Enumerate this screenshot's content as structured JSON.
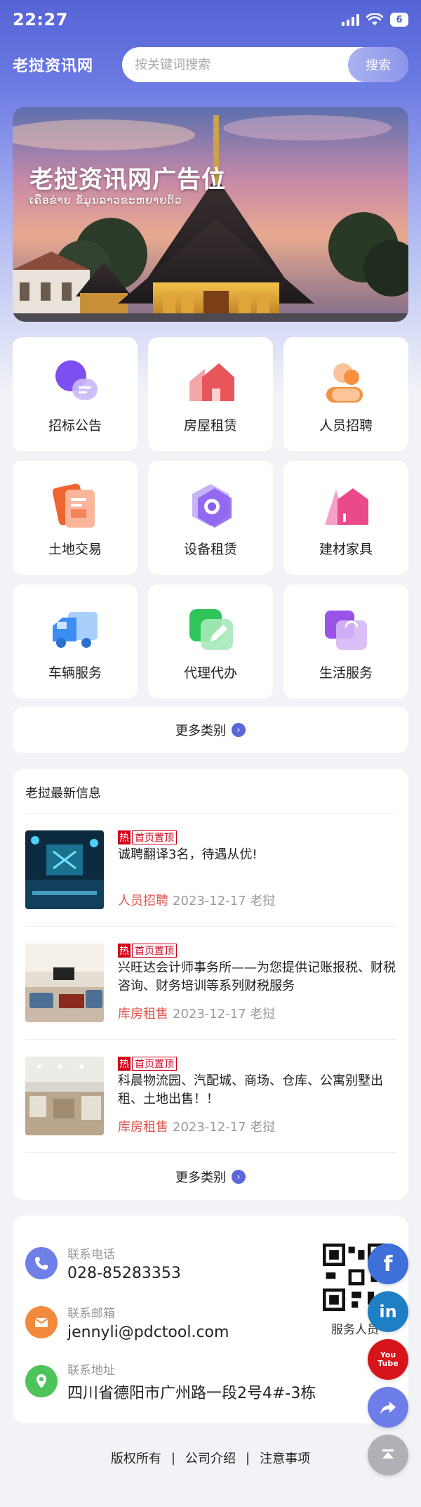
{
  "status_bar": {
    "time": "22:27",
    "battery": "6"
  },
  "header": {
    "logo": "老挝资讯网",
    "search_placeholder": "按关键词搜索",
    "search_button": "搜索"
  },
  "banner": {
    "title": "老挝资讯网广告位",
    "subtitle": "ເຄືອຂ່າຍ ຂໍ້ມູນລາວຂະຫຍາຍຕົວ"
  },
  "categories": [
    {
      "label": "招标公告",
      "icon": "chat-bubble-icon",
      "color": "#7b4ff0"
    },
    {
      "label": "房屋租赁",
      "icon": "house-icon",
      "color": "#e8555a"
    },
    {
      "label": "人员招聘",
      "icon": "person-icon",
      "color": "#f5913e"
    },
    {
      "label": "土地交易",
      "icon": "document-icon",
      "color": "#f0642f"
    },
    {
      "label": "设备租赁",
      "icon": "hexagon-gear-icon",
      "color": "#8a5cf0"
    },
    {
      "label": "建材家具",
      "icon": "building-icon",
      "color": "#e84a8a"
    },
    {
      "label": "车辆服务",
      "icon": "truck-icon",
      "color": "#3d8ef2"
    },
    {
      "label": "代理代办",
      "icon": "pencil-note-icon",
      "color": "#2fc55a"
    },
    {
      "label": "生活服务",
      "icon": "shopping-bag-icon",
      "color": "#9b52e8"
    }
  ],
  "more_categories": "更多类别",
  "news": {
    "title": "老挝最新信息",
    "hot_tag": "热",
    "top_tag": "首页置顶",
    "items": [
      {
        "text": "诚聘翻译3名，待遇从优!",
        "category": "人员招聘",
        "date": "2023-12-17",
        "location": "老挝"
      },
      {
        "text": "兴旺达会计师事务所——为您提供记账报税、财税咨询、财务培训等系列财税服务",
        "category": "库房租售",
        "date": "2023-12-17",
        "location": "老挝"
      },
      {
        "text": "科晨物流园、汽配城、商场、仓库、公寓别墅出租、土地出售！！",
        "category": "库房租售",
        "date": "2023-12-17",
        "location": "老挝"
      }
    ],
    "more": "更多类别"
  },
  "contact": {
    "phone_label": "联系电话",
    "phone": "028-85283353",
    "email_label": "联系邮箱",
    "email": "jennyli@pdctool.com",
    "address_label": "联系地址",
    "address": "四川省德阳市广州路一段2号4#-3栋",
    "qr_label": "服务人员"
  },
  "footer": {
    "links": [
      "版权所有",
      "公司介绍",
      "注意事项"
    ],
    "separator": "|"
  },
  "floating": {
    "facebook": "f",
    "linkedin": "in",
    "youtube": "You Tube"
  }
}
